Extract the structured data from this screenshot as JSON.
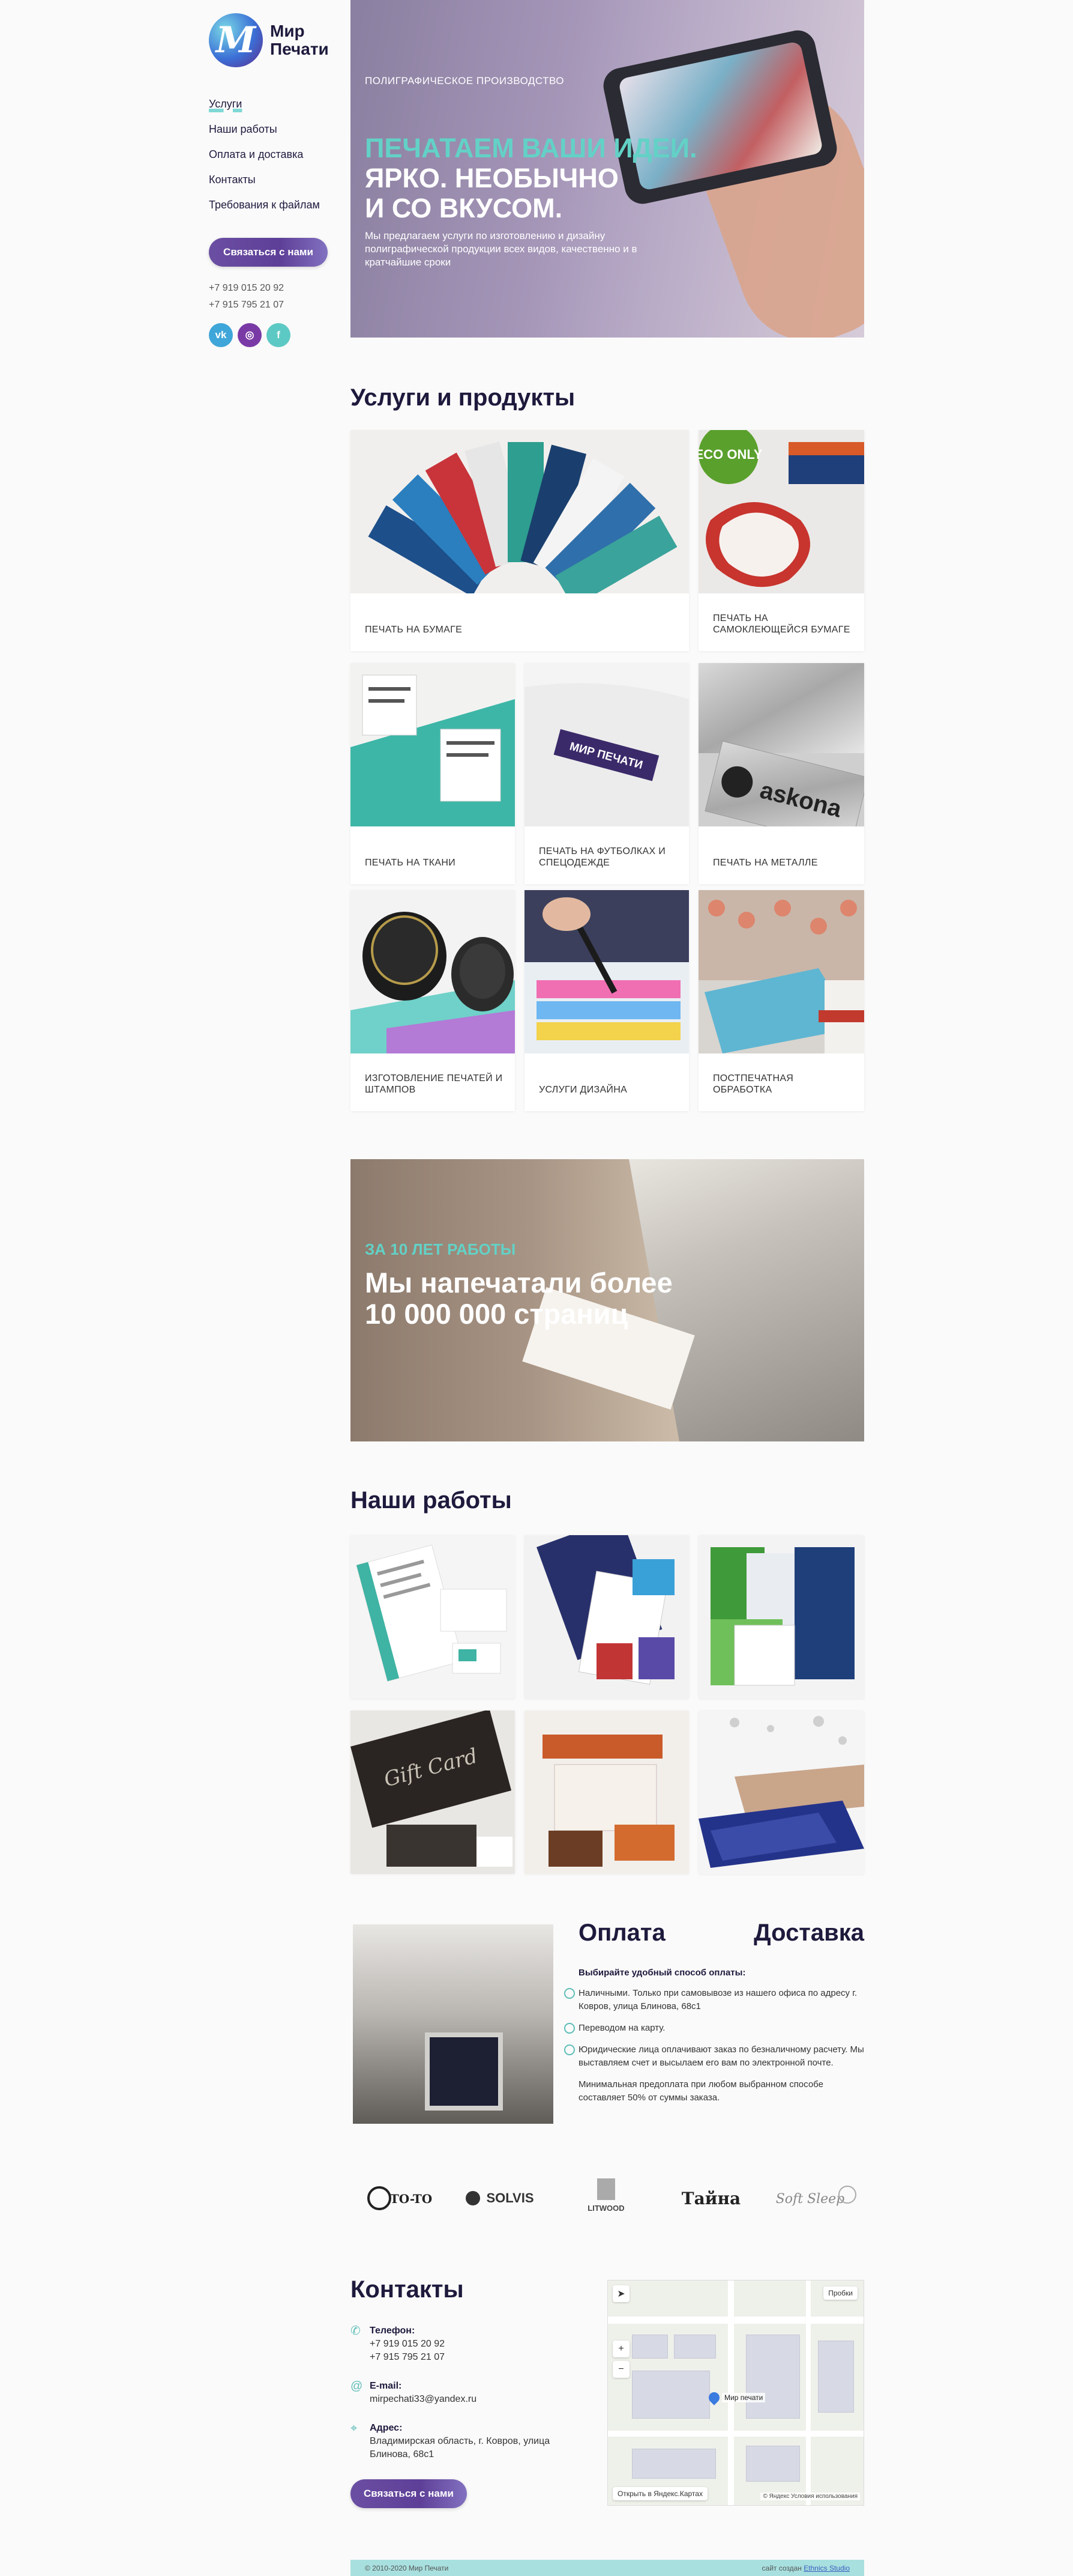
{
  "brand": {
    "logo_letter": "М",
    "name_line1": "Мир",
    "name_line2": "Печати"
  },
  "nav": [
    {
      "label": "Услуги"
    },
    {
      "label": "Наши работы"
    },
    {
      "label": "Оплата и доставка"
    },
    {
      "label": "Контакты"
    },
    {
      "label": "Требования к файлам"
    }
  ],
  "sidebar": {
    "cta": "Связаться с нами",
    "phones": [
      "+7 919 015 20 92",
      "+7 915 795 21 07"
    ],
    "socials": [
      {
        "name": "vk-icon",
        "glyph": "vk"
      },
      {
        "name": "instagram-icon",
        "glyph": "◎"
      },
      {
        "name": "facebook-icon",
        "glyph": "f"
      }
    ]
  },
  "hero": {
    "label": "ПОЛИГРАФИЧЕСКОЕ ПРОИЗВОДСТВО",
    "title_accent": "ПЕЧАТАЕМ ВАШИ ИДЕИ.",
    "title_line2": "ЯРКО. НЕОБЫЧНО",
    "title_line3": "И СО ВКУСОМ.",
    "subtitle": "Мы предлагаем услуги по изготовлению и дизайну полиграфической продукции всех видов, качественно и в кратчайшие сроки"
  },
  "services": {
    "title": "Услуги и продукты",
    "items": [
      {
        "caption": "ПЕЧАТЬ НА БУМАГЕ"
      },
      {
        "caption": "ПЕЧАТЬ НА САМОКЛЕЮЩЕЙСЯ БУМАГЕ"
      },
      {
        "caption": "ПЕЧАТЬ НА ТКАНИ"
      },
      {
        "caption": "ПЕЧАТЬ НА ФУТБОЛКАХ И СПЕЦОДЕЖДЕ"
      },
      {
        "caption": "ПЕЧАТЬ НА МЕТАЛЛЕ"
      },
      {
        "caption": "ИЗГОТОВЛЕНИЕ ПЕЧАТЕЙ И ШТАМПОВ"
      },
      {
        "caption": "УСЛУГИ ДИЗАЙНА"
      },
      {
        "caption": "ПОСТПЕЧАТНАЯ ОБРАБОТКА"
      }
    ],
    "image_text": {
      "eco": "ECO ONLY",
      "tshirt": "МИР ПЕЧАТИ",
      "metal": "askona"
    }
  },
  "stats": {
    "kicker": "ЗА 10 ЛЕТ РАБОТЫ",
    "title": "Мы напечатали более 10 000 000 страниц"
  },
  "works": {
    "title": "Наши работы",
    "image_text": {
      "gift": "Gift Card"
    }
  },
  "payment": {
    "title_left": "Оплата",
    "title_right": "Доставка",
    "lead": "Выбирайте удобный способ оплаты:",
    "options": [
      "Наличными. Только при самовывозе из нашего офиса по адресу г. Ковров, улица Блинова, 68с1",
      "Переводом на карту.",
      "Юридические лица оплачивают заказ по безналичному расчету. Мы выставляем счет и высылаем его вам по электронной почте."
    ],
    "note": "Минимальная предоплата при любом выбранном способе составляет 50% от суммы заказа."
  },
  "partners": [
    "TO-TO",
    "SOLVIS",
    "LITWOOD",
    "Тайна",
    "Soft Sleep"
  ],
  "contacts": {
    "title": "Контакты",
    "phone_label": "Телефон:",
    "phones": [
      "+7 919 015 20 92",
      "+7 915 795 21 07"
    ],
    "email_label": "E-mail:",
    "email": "mirpechati33@yandex.ru",
    "address_label": "Адрес:",
    "address": "Владимирская область, г. Ковров, улица Блинова, 68с1",
    "cta": "Связаться с нами"
  },
  "map": {
    "traffic": "Пробки",
    "marker": "Мир печати",
    "open_link": "Открыть в Яндекс.Картах",
    "copyright": "© Яндекс Условия использования"
  },
  "footer": {
    "copyright": "© 2010-2020 Мир Печати",
    "credit_prefix": "сайт создан",
    "credit_link": "Ethnics Studio"
  },
  "colors": {
    "accent": "#63d1c6",
    "brand_purple": "#5e3f98",
    "dark_text": "#1d1a3d"
  }
}
